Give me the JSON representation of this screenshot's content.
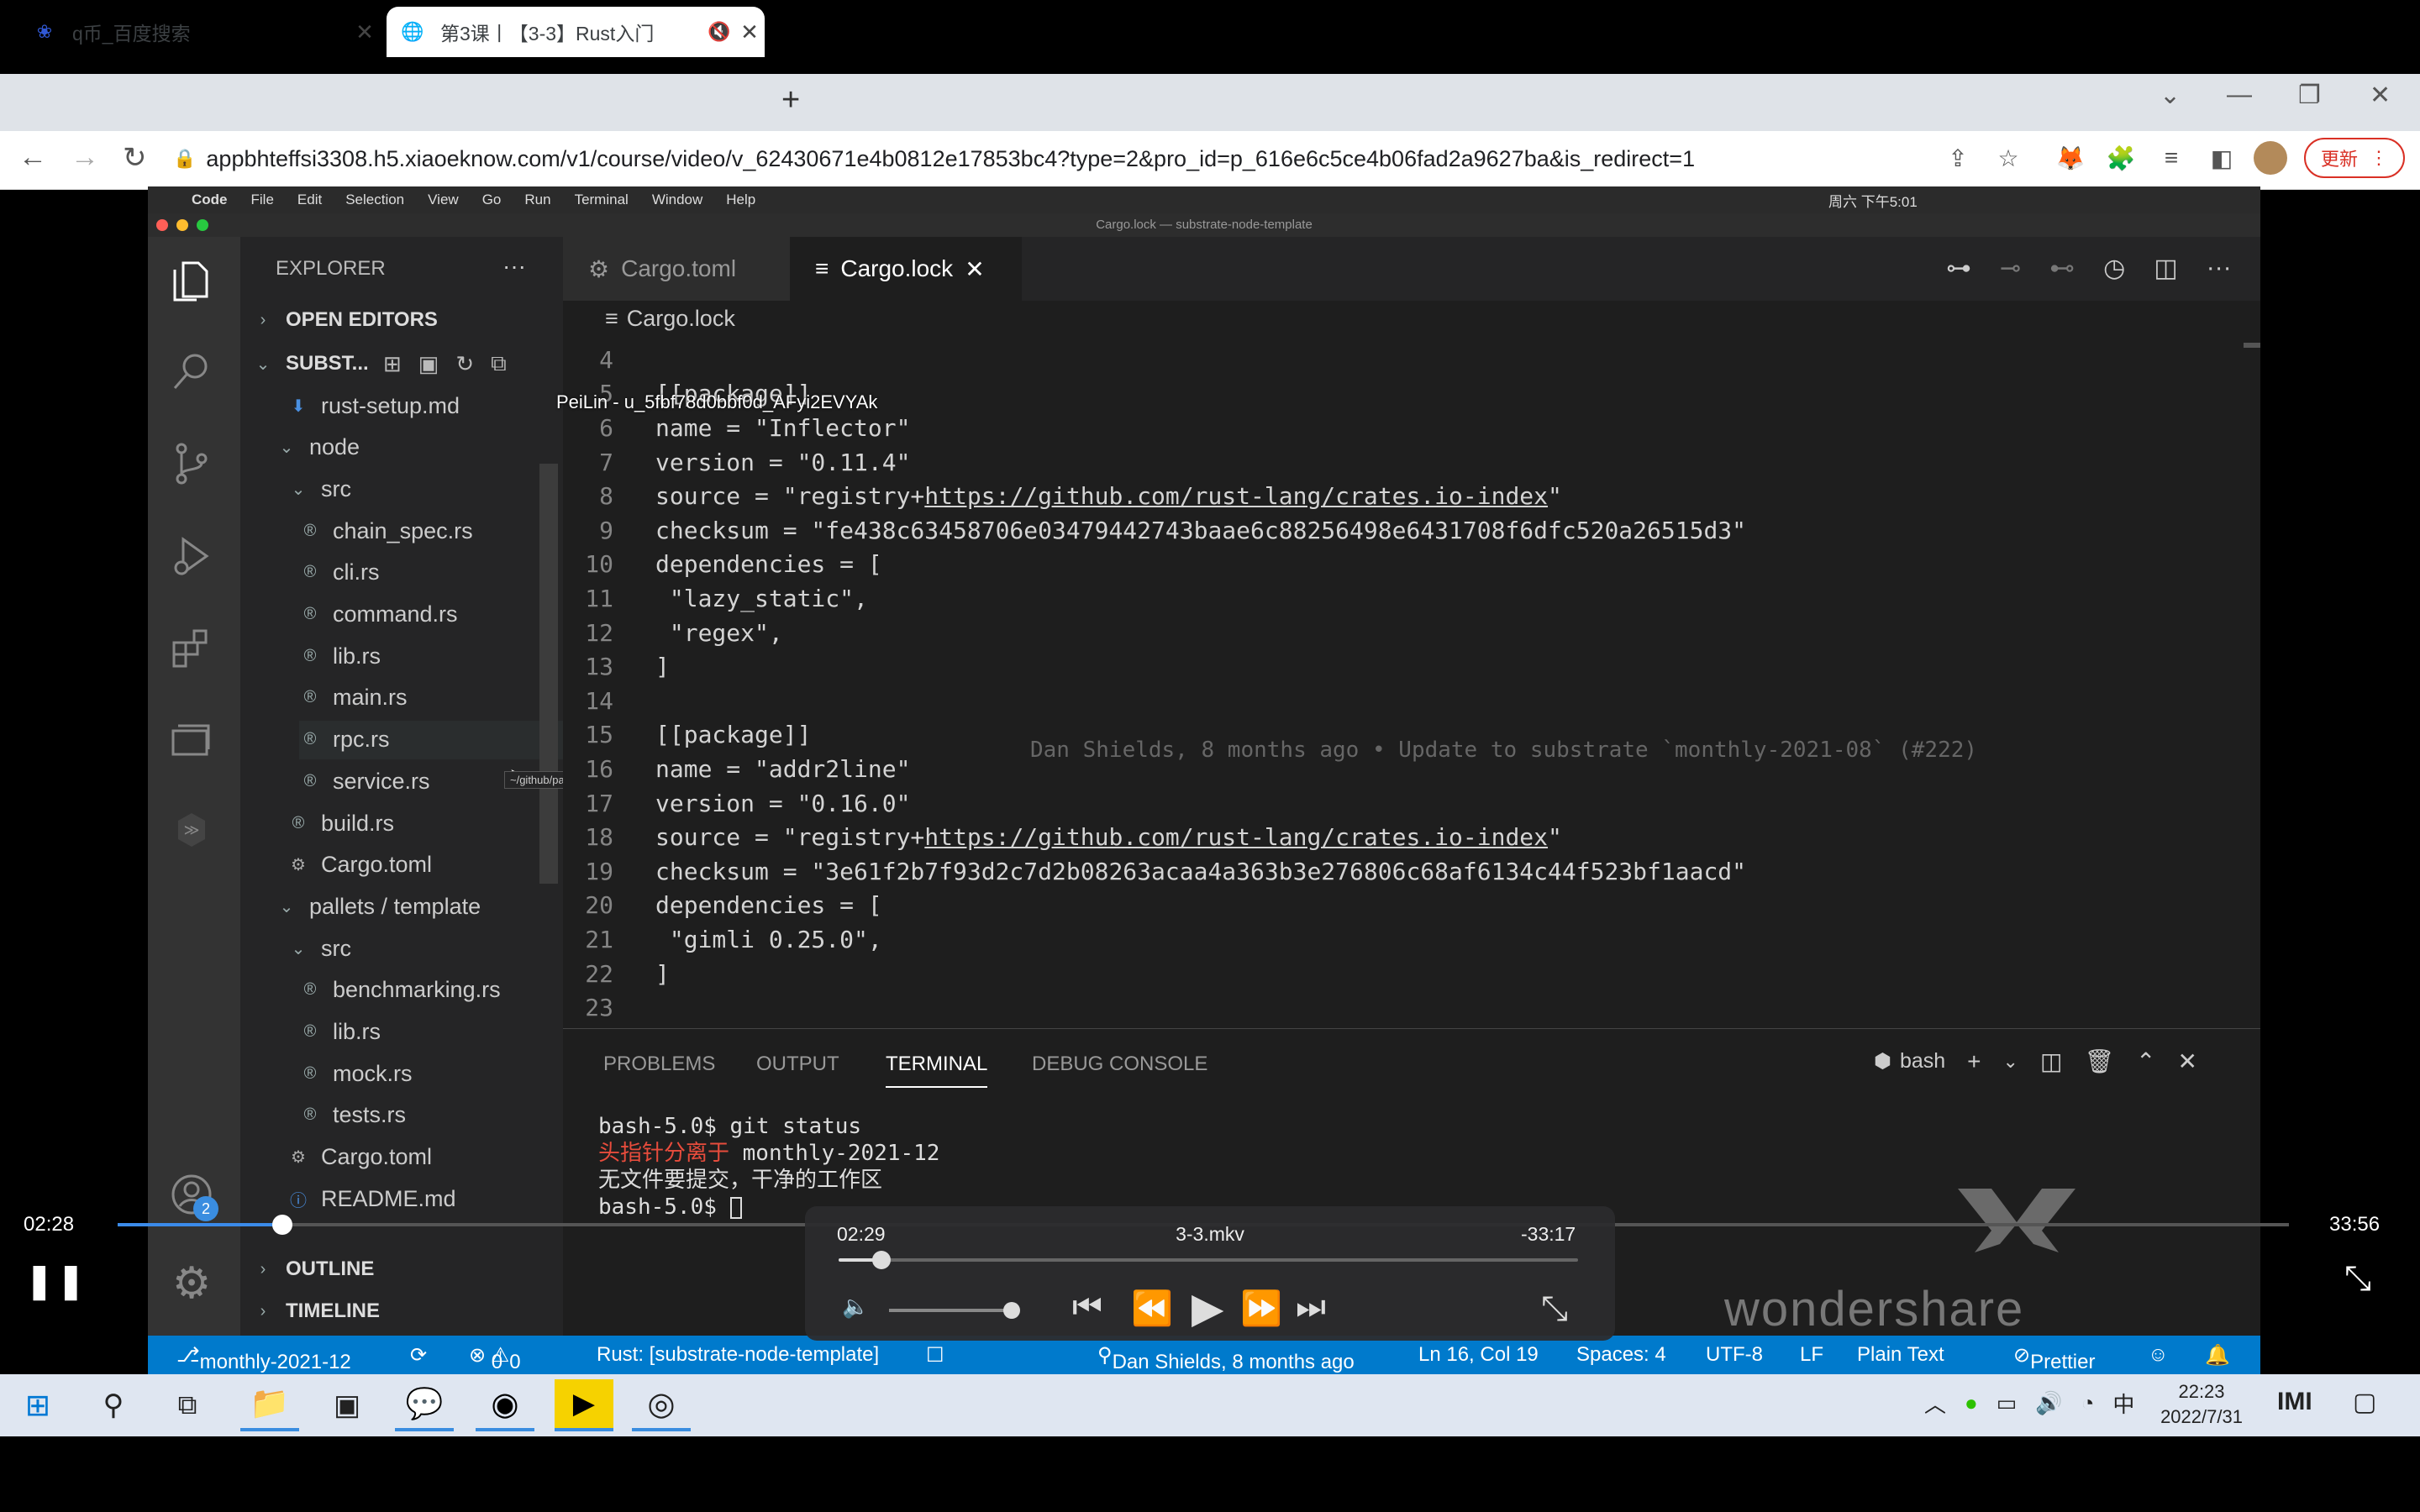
{
  "browser": {
    "tabs": [
      {
        "title": "q币_百度搜索",
        "icon": "baidu-paw-icon"
      },
      {
        "title": "第3课丨【3-3】Rust入门",
        "icon": "globe-icon"
      }
    ],
    "url": "appbhteffsi3308.h5.xiaoeknow.com/v1/course/video/v_62430671e4b0812e17853bc4?type=2&pro_id=p_616e6c5ce4b06fad2a9627ba&is_redirect=1",
    "update_label": "更新"
  },
  "mac_menu": [
    "Code",
    "File",
    "Edit",
    "Selection",
    "View",
    "Go",
    "Run",
    "Terminal",
    "Window",
    "Help"
  ],
  "mac_clock": "周六 下午5:01",
  "window_title": "Cargo.lock — substrate-node-template",
  "watermark_user": "PeiLin - u_5fbf78d0bbf0d_AFyi2EVYAk",
  "explorer": {
    "title": "EXPLORER",
    "open_editors": "OPEN EDITORS",
    "workspace": "SUBST...",
    "tree": [
      {
        "label": "rust-setup.md",
        "icon": "markdown-icon"
      },
      {
        "label": "node",
        "icon": "chevron-down-icon"
      },
      {
        "label": "src",
        "icon": "chevron-down-icon"
      },
      {
        "label": "chain_spec.rs",
        "icon": "rust-file-icon"
      },
      {
        "label": "cli.rs",
        "icon": "rust-file-icon"
      },
      {
        "label": "command.rs",
        "icon": "rust-file-icon"
      },
      {
        "label": "lib.rs",
        "icon": "rust-file-icon"
      },
      {
        "label": "main.rs",
        "icon": "rust-file-icon"
      },
      {
        "label": "rpc.rs",
        "icon": "rust-file-icon"
      },
      {
        "label": "service.rs",
        "icon": "rust-file-icon"
      },
      {
        "label": "build.rs",
        "icon": "rust-file-icon"
      },
      {
        "label": "Cargo.toml",
        "icon": "gear-icon"
      },
      {
        "label": "pallets / template",
        "icon": "chevron-down-icon"
      },
      {
        "label": "src",
        "icon": "chevron-down-icon"
      },
      {
        "label": "benchmarking.rs",
        "icon": "rust-file-icon"
      },
      {
        "label": "lib.rs",
        "icon": "rust-file-icon"
      },
      {
        "label": "mock.rs",
        "icon": "rust-file-icon"
      },
      {
        "label": "tests.rs",
        "icon": "rust-file-icon"
      },
      {
        "label": "Cargo.toml",
        "icon": "gear-icon"
      },
      {
        "label": "README.md",
        "icon": "info-icon"
      }
    ],
    "tooltip": "~/github/parachains/substrate-node-template/node/src/rpc.rs",
    "outline": "OUTLINE",
    "timeline": "TIMELINE",
    "accounts_badge": "2"
  },
  "editor": {
    "tabs": [
      {
        "label": "Cargo.toml",
        "icon": "gear-icon"
      },
      {
        "label": "Cargo.lock",
        "icon": "lines-icon"
      }
    ],
    "breadcrumb": "Cargo.lock",
    "lines": [
      {
        "n": "4",
        "t": ""
      },
      {
        "n": "5",
        "t": "[[package]]"
      },
      {
        "n": "6",
        "t": "name = \"Inflector\""
      },
      {
        "n": "7",
        "t": "version = \"0.11.4\""
      },
      {
        "n": "8",
        "t": "source = \"registry+",
        "link": "https://github.com/rust-lang/crates.io-index",
        "after": "\""
      },
      {
        "n": "9",
        "t": "checksum = \"fe438c63458706e03479442743baae6c88256498e6431708f6dfc520a26515d3\""
      },
      {
        "n": "10",
        "t": "dependencies = ["
      },
      {
        "n": "11",
        "t": " \"lazy_static\","
      },
      {
        "n": "12",
        "t": " \"regex\","
      },
      {
        "n": "13",
        "t": "]"
      },
      {
        "n": "14",
        "t": ""
      },
      {
        "n": "15",
        "t": "[[package]]"
      },
      {
        "n": "16",
        "t": "name = \"addr2line\""
      },
      {
        "n": "17",
        "t": "version = \"0.16.0\""
      },
      {
        "n": "18",
        "t": "source = \"registry+",
        "link": "https://github.com/rust-lang/crates.io-index",
        "after": "\""
      },
      {
        "n": "19",
        "t": "checksum = \"3e61f2b7f93d2c7d2b08263acaa4a363b3e276806c68af6134c44f523bf1aacd\""
      },
      {
        "n": "20",
        "t": "dependencies = ["
      },
      {
        "n": "21",
        "t": " \"gimli 0.25.0\","
      },
      {
        "n": "22",
        "t": "]"
      },
      {
        "n": "23",
        "t": ""
      }
    ],
    "blame": "Dan Shields, 8 months ago • Update to substrate `monthly-2021-08` (#222)"
  },
  "panel": {
    "tabs": [
      "PROBLEMS",
      "OUTPUT",
      "TERMINAL",
      "DEBUG CONSOLE"
    ],
    "shell": "bash",
    "terminal": [
      "bash-5.0$ git status",
      "头指针分离于 ",
      "monthly-2021-12",
      "无文件要提交，干净的工作区",
      "bash-5.0$ "
    ]
  },
  "statusbar": {
    "branch": "monthly-2021-12",
    "errors": "0",
    "warnings": "0",
    "rust": "Rust: [substrate-node-template]",
    "blame": "Dan Shields, 8 months ago",
    "position": "Ln 16, Col 19",
    "spaces": "Spaces: 4",
    "encoding": "UTF-8",
    "eol": "LF",
    "language": "Plain Text",
    "prettier": "Prettier"
  },
  "player": {
    "elapsed_outer": "02:28",
    "total_outer": "33:56",
    "elapsed": "02:29",
    "filename": "3-3.mkv",
    "remaining": "-33:17",
    "watermark": "wondershare"
  },
  "taskbar": {
    "time": "22:23",
    "date": "2022/7/31",
    "ime": "中"
  }
}
